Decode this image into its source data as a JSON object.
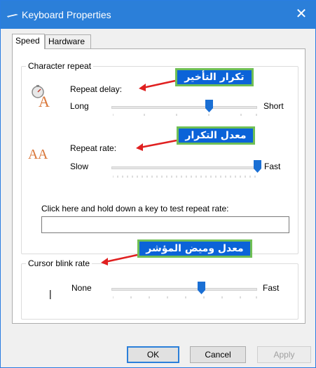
{
  "window": {
    "title": "Keyboard Properties",
    "close_glyph": "✕"
  },
  "tabs": [
    {
      "label": "Speed",
      "active": true
    },
    {
      "label": "Hardware",
      "active": false
    }
  ],
  "character_repeat": {
    "group_title": "Character repeat",
    "repeat_delay": {
      "label": "Repeat delay:",
      "min_label": "Long",
      "max_label": "Short",
      "value_fraction": 0.67,
      "icon": "stopwatch-letter-a-icon"
    },
    "repeat_rate": {
      "label": "Repeat rate:",
      "min_label": "Slow",
      "max_label": "Fast",
      "value_fraction": 1.0,
      "icon": "double-letter-a-icon"
    },
    "test_label": "Click here and hold down a key to test repeat rate:",
    "test_value": ""
  },
  "cursor_blink": {
    "group_title": "Cursor blink rate",
    "min_label": "None",
    "max_label": "Fast",
    "value_fraction": 0.62,
    "cursor_glyph": "|"
  },
  "annotations": {
    "delay": "تكرار التأخير",
    "rate": "معدل التكرار",
    "blink": "معدل وميض المؤشر",
    "arrow_color": "#e02020",
    "box_color": "#0b63d8",
    "border_color": "#6fbf55"
  },
  "buttons": {
    "ok": "OK",
    "cancel": "Cancel",
    "apply": "Apply"
  },
  "colors": {
    "titlebar": "#2b7fd9",
    "slider_thumb": "#1a6fd4"
  }
}
